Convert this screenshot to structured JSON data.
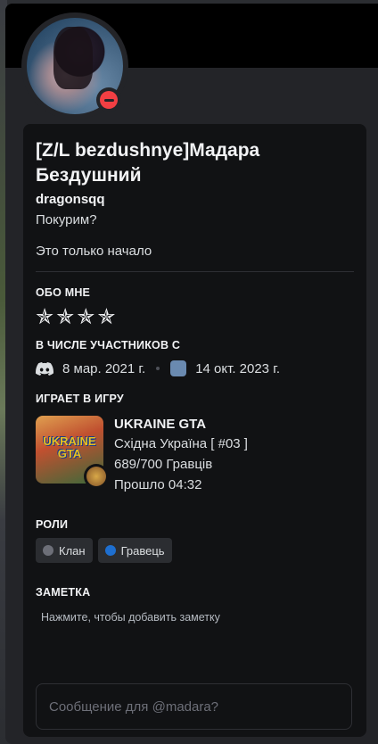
{
  "profile": {
    "display_name": "[Z/L bezdushnye]Мадара Бездушний",
    "username": "dragonsqq",
    "pronouns": "Покурим?",
    "custom_status": "Это только начало",
    "status": "do-not-disturb"
  },
  "about": {
    "title": "ОБО МНЕ",
    "text": "✯✯✯✯"
  },
  "member_since": {
    "title": "В ЧИСЛЕ УЧАСТНИКОВ С",
    "discord_date": "8 мар. 2021 г.",
    "server_date": "14 окт. 2023 г."
  },
  "activity": {
    "title": "ИГРАЕТ В ИГРУ",
    "art_text": "UKRAINE GTA",
    "name": "UKRAINE GTA",
    "details": "Східна Україна [ #03 ]",
    "state": "689/700 Гравців",
    "elapsed": "Прошло 04:32"
  },
  "roles": {
    "title": "РОЛИ",
    "items": [
      {
        "label": "Клан",
        "color": "#6d6f78"
      },
      {
        "label": "Гравець",
        "color": "#1e6fd0"
      }
    ]
  },
  "note": {
    "title": "ЗАМЕТКА",
    "placeholder": "Нажмите, чтобы добавить заметку"
  },
  "message": {
    "placeholder": "Сообщение для @madara?"
  },
  "colors": {
    "background": "#232428",
    "card": "#111214",
    "dnd": "#f23f43"
  }
}
